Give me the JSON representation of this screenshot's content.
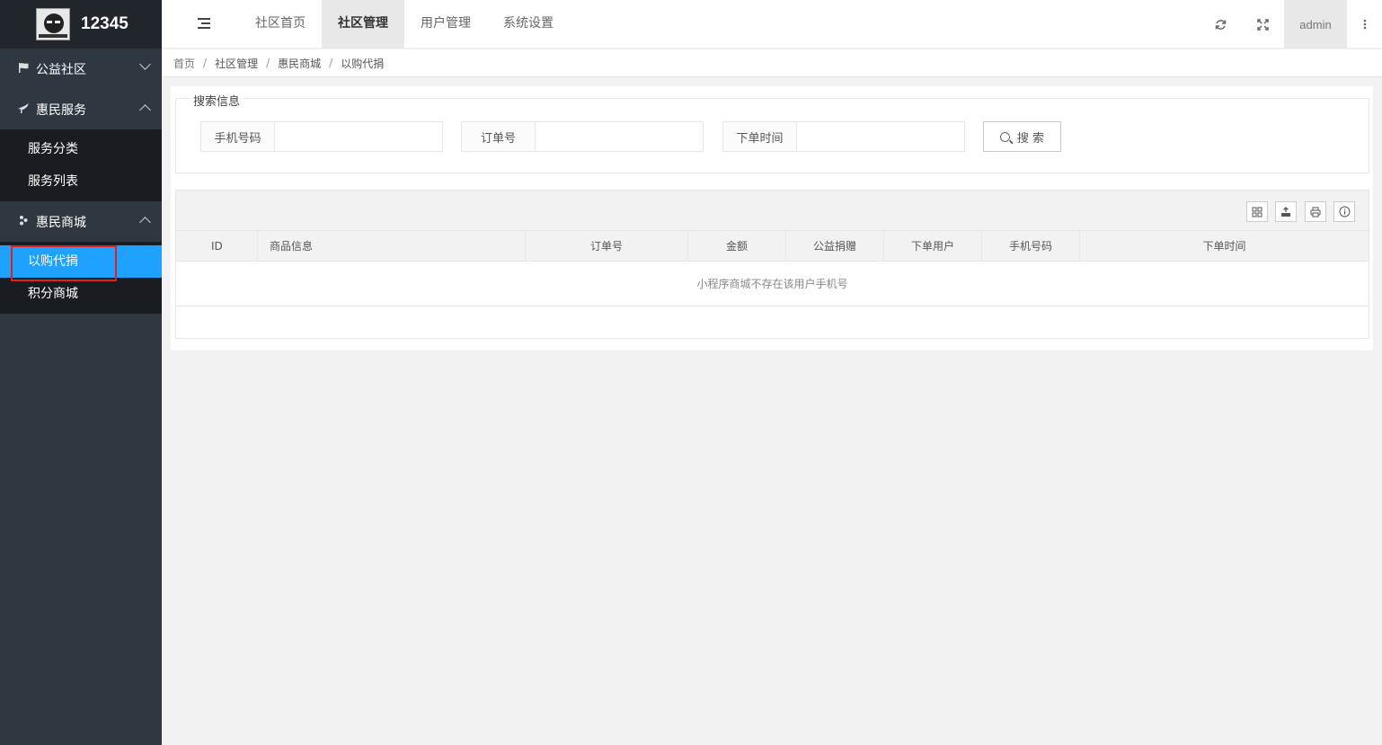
{
  "sidebar": {
    "logo_text": "12345",
    "groups": [
      {
        "label": "公益社区",
        "icon": "flag-icon",
        "expanded": false
      },
      {
        "label": "惠民服务",
        "icon": "tool-icon",
        "expanded": true,
        "items": [
          "服务分类",
          "服务列表"
        ]
      },
      {
        "label": "惠民商城",
        "icon": "shop-icon",
        "expanded": true,
        "items": [
          "以购代捐",
          "积分商城"
        ],
        "active_item": "以购代捐"
      }
    ]
  },
  "topbar": {
    "tabs": [
      "社区首页",
      "社区管理",
      "用户管理",
      "系统设置"
    ],
    "active_tab": "社区管理",
    "user": "admin",
    "icons": [
      "refresh-icon",
      "fullscreen-icon",
      "more-icon"
    ]
  },
  "breadcrumb": [
    "首页",
    "社区管理",
    "惠民商城",
    "以购代捐"
  ],
  "search": {
    "legend": "搜索信息",
    "fields": [
      {
        "label": "手机号码",
        "value": "",
        "placeholder": ""
      },
      {
        "label": "订单号",
        "value": "",
        "placeholder": ""
      },
      {
        "label": "下单时间",
        "value": "",
        "placeholder": ""
      }
    ],
    "button_label": "搜 索"
  },
  "table": {
    "toolbar_icons": [
      "columns-icon",
      "export-icon",
      "print-icon",
      "info-icon"
    ],
    "columns": [
      "ID",
      "商品信息",
      "订单号",
      "金额",
      "公益捐赠",
      "下单用户",
      "手机号码",
      "下单时间"
    ],
    "empty_text": "小程序商城不存在该用户手机号"
  }
}
